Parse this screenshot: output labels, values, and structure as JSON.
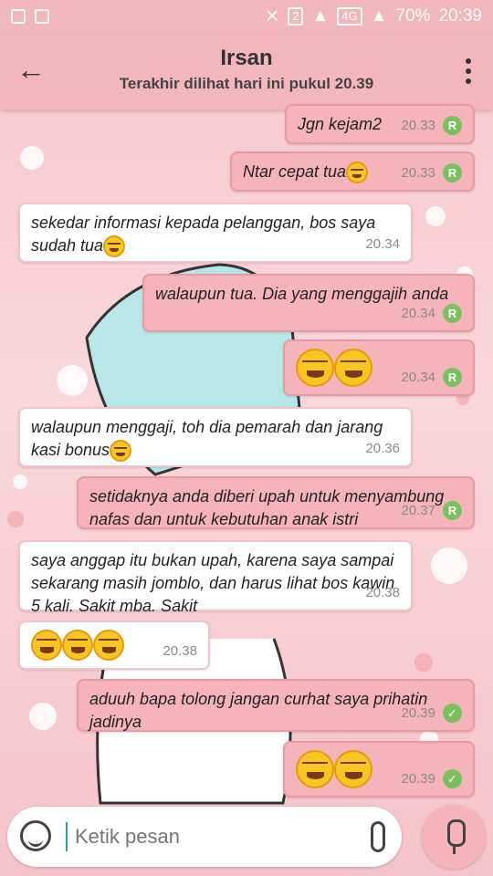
{
  "status_bar": {
    "network": "4G",
    "sim": "2",
    "battery": "70%",
    "time": "20:39"
  },
  "header": {
    "title": "Irsan",
    "subtitle": "Terakhir dilihat hari ini pukul 20.39"
  },
  "messages": [
    {
      "dir": "out",
      "text": "Jgn kejam2",
      "time": "20.33",
      "status": "R"
    },
    {
      "dir": "out",
      "text": "Ntar cepat tua",
      "time": "20.33",
      "status": "R"
    },
    {
      "dir": "in",
      "text": "sekedar informasi kepada pelanggan, bos saya sudah tua",
      "time": "20.34"
    },
    {
      "dir": "out",
      "text": "walaupun tua. Dia yang menggajih anda",
      "time": "20.34",
      "status": "R"
    },
    {
      "dir": "out",
      "text": "",
      "time": "20.34",
      "status": "R"
    },
    {
      "dir": "in",
      "text": "walaupun menggaji, toh dia pemarah dan jarang kasi bonus",
      "time": "20.36"
    },
    {
      "dir": "out",
      "text": "setidaknya anda diberi upah untuk menyambung nafas dan untuk kebutuhan anak istri",
      "time": "20.37",
      "status": "R"
    },
    {
      "dir": "in",
      "text": "saya anggap itu bukan upah, karena saya sampai sekarang masih jomblo, dan harus lihat bos kawin 5 kali. Sakit mba. Sakit",
      "time": "20.38"
    },
    {
      "dir": "in",
      "text": "",
      "time": "20.38"
    },
    {
      "dir": "out",
      "text": "aduuh bapa tolong jangan curhat saya prihatin jadinya",
      "time": "20.39",
      "status": "read"
    },
    {
      "dir": "out",
      "text": "",
      "time": "20.39",
      "status": "read"
    }
  ],
  "input": {
    "placeholder": "Ketik pesan"
  },
  "icons": {
    "back": "arrow-left-icon",
    "menu": "more-vertical-icon",
    "emoji": "smiley-icon",
    "attach": "paperclip-icon",
    "mic": "microphone-icon"
  }
}
